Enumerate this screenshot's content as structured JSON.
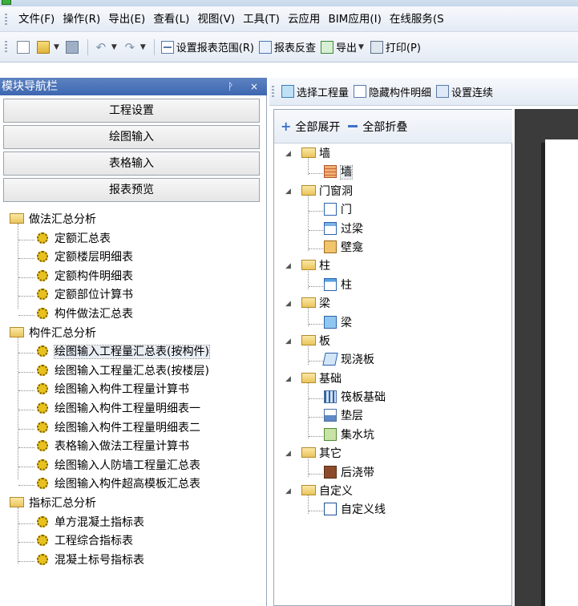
{
  "menu": [
    "文件(F)",
    "操作(R)",
    "导出(E)",
    "查看(L)",
    "视图(V)",
    "工具(T)",
    "云应用",
    "BIM应用(I)",
    "在线服务(S"
  ],
  "toolbar": {
    "set_range": "设置报表范围(R)",
    "reverse_check": "报表反查",
    "export": "导出",
    "print": "打印(P)"
  },
  "nav": {
    "title": "模块导航栏",
    "pin": "ᚹ",
    "close": "×",
    "buttons": [
      "工程设置",
      "绘图输入",
      "表格输入",
      "报表预览"
    ],
    "groups": [
      {
        "label": "做法汇总分析",
        "items": [
          "定额汇总表",
          "定额楼层明细表",
          "定额构件明细表",
          "定额部位计算书",
          "构件做法汇总表"
        ]
      },
      {
        "label": "构件汇总分析",
        "items": [
          "绘图输入工程量汇总表(按构件)",
          "绘图输入工程量汇总表(按楼层)",
          "绘图输入构件工程量计算书",
          "绘图输入构件工程量明细表一",
          "绘图输入构件工程量明细表二",
          "表格输入做法工程量计算书",
          "绘图输入人防墙工程量汇总表",
          "绘图输入构件超高模板汇总表"
        ]
      },
      {
        "label": "指标汇总分析",
        "items": [
          "单方混凝土指标表",
          "工程综合指标表",
          "混凝土标号指标表"
        ]
      }
    ]
  },
  "right_toolbar": {
    "select_qty": "选择工程量",
    "hide_detail": "隐藏构件明细",
    "set_link": "设置连续"
  },
  "tree_header": {
    "expand_all": "全部展开",
    "collapse_all": "全部折叠"
  },
  "components": [
    {
      "label": "墙",
      "items": [
        {
          "label": "墙",
          "icon": "wall"
        }
      ]
    },
    {
      "label": "门窗洞",
      "items": [
        {
          "label": "门",
          "icon": "door"
        },
        {
          "label": "过梁",
          "icon": "lintel"
        },
        {
          "label": "壁龛",
          "icon": "niche"
        }
      ]
    },
    {
      "label": "柱",
      "items": [
        {
          "label": "柱",
          "icon": "column"
        }
      ]
    },
    {
      "label": "梁",
      "items": [
        {
          "label": "梁",
          "icon": "beam"
        }
      ]
    },
    {
      "label": "板",
      "items": [
        {
          "label": "现浇板",
          "icon": "slab"
        }
      ]
    },
    {
      "label": "基础",
      "items": [
        {
          "label": "筏板基础",
          "icon": "raft"
        },
        {
          "label": "垫层",
          "icon": "cushion"
        },
        {
          "label": "集水坑",
          "icon": "sump"
        }
      ]
    },
    {
      "label": "其它",
      "items": [
        {
          "label": "后浇带",
          "icon": "pour"
        }
      ]
    },
    {
      "label": "自定义",
      "items": [
        {
          "label": "自定义线",
          "icon": "line"
        }
      ]
    }
  ]
}
